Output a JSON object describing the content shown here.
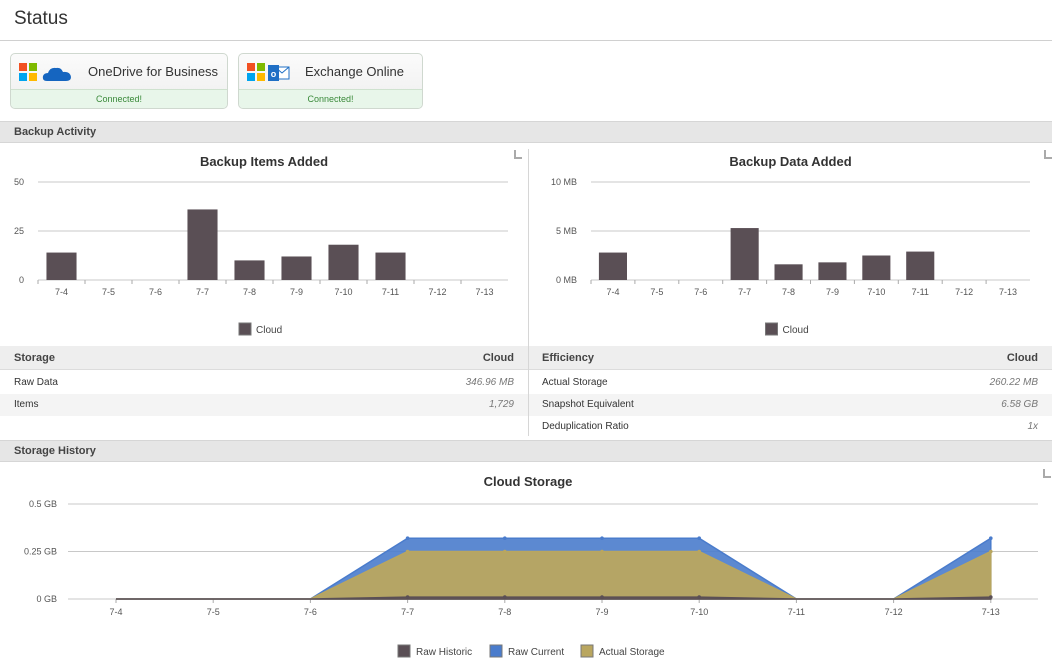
{
  "page": {
    "title": "Status"
  },
  "services": [
    {
      "name": "OneDrive for Business",
      "status": "Connected!"
    },
    {
      "name": "Exchange Online",
      "status": "Connected!"
    }
  ],
  "sections": {
    "backup_activity": "Backup Activity",
    "storage_history": "Storage History"
  },
  "storage": {
    "heading": "Storage",
    "col": "Cloud",
    "rows": [
      {
        "label": "Raw Data",
        "value": "346.96 MB"
      },
      {
        "label": "Items",
        "value": "1,729"
      }
    ]
  },
  "efficiency": {
    "heading": "Efficiency",
    "col": "Cloud",
    "rows": [
      {
        "label": "Actual Storage",
        "value": "260.22 MB"
      },
      {
        "label": "Snapshot Equivalent",
        "value": "6.58 GB"
      },
      {
        "label": "Deduplication Ratio",
        "value": "1x"
      }
    ]
  },
  "colors": {
    "cloud": "#5a4f55",
    "raw_historic": "#5a4f55",
    "raw_current": "#4a7ccc",
    "actual_storage": "#b9a65f"
  },
  "chart_data": [
    {
      "id": "items",
      "type": "bar",
      "title": "Backup Items Added",
      "categories": [
        "7-4",
        "7-5",
        "7-6",
        "7-7",
        "7-8",
        "7-9",
        "7-10",
        "7-11",
        "7-12",
        "7-13"
      ],
      "series": [
        {
          "name": "Cloud",
          "values": [
            14,
            0,
            0,
            36,
            10,
            12,
            18,
            14,
            0,
            0
          ]
        }
      ],
      "ylim": [
        0,
        50
      ],
      "yticks": [
        0,
        25,
        50
      ],
      "yticklabels": [
        "0",
        "25",
        "50"
      ],
      "grid": true,
      "legend": "bottom"
    },
    {
      "id": "data",
      "type": "bar",
      "title": "Backup Data Added",
      "categories": [
        "7-4",
        "7-5",
        "7-6",
        "7-7",
        "7-8",
        "7-9",
        "7-10",
        "7-11",
        "7-12",
        "7-13"
      ],
      "series": [
        {
          "name": "Cloud",
          "values": [
            2.8,
            0,
            0,
            5.3,
            1.6,
            1.8,
            2.5,
            2.9,
            0,
            0
          ]
        }
      ],
      "ylim": [
        0,
        10
      ],
      "yticks": [
        0,
        5,
        10
      ],
      "yticklabels": [
        "0 MB",
        "5 MB",
        "10 MB"
      ],
      "grid": true,
      "legend": "bottom"
    },
    {
      "id": "history",
      "type": "area",
      "title": "Cloud Storage",
      "categories": [
        "7-4",
        "7-5",
        "7-6",
        "7-7",
        "7-8",
        "7-9",
        "7-10",
        "7-11",
        "7-12",
        "7-13"
      ],
      "series": [
        {
          "name": "Raw Historic",
          "values": [
            0,
            0,
            0,
            0.01,
            0.01,
            0.01,
            0.01,
            0,
            0,
            0.01
          ]
        },
        {
          "name": "Raw Current",
          "values": [
            0,
            0,
            0,
            0.32,
            0.32,
            0.32,
            0.32,
            0,
            0,
            0.32
          ]
        },
        {
          "name": "Actual Storage",
          "values": [
            0,
            0,
            0,
            0.25,
            0.25,
            0.25,
            0.25,
            0,
            0,
            0.25
          ]
        }
      ],
      "ylim": [
        0,
        0.5
      ],
      "yticks": [
        0,
        0.25,
        0.5
      ],
      "yticklabels": [
        "0 GB",
        "0.25 GB",
        "0.5 GB"
      ],
      "grid": true,
      "legend": "bottom"
    }
  ]
}
